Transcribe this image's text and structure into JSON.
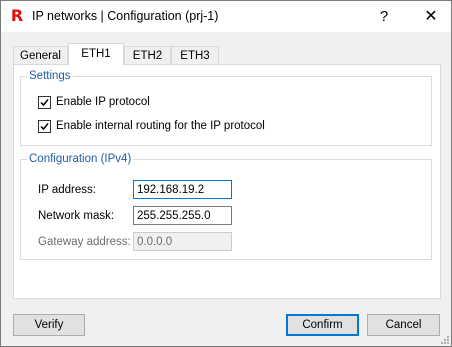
{
  "window": {
    "title": "IP networks | Configuration (prj-1)",
    "app_icon": "R",
    "help_glyph": "?",
    "close_glyph": "✕"
  },
  "tabs": [
    {
      "label": "General",
      "active": false
    },
    {
      "label": "ETH1",
      "active": true
    },
    {
      "label": "ETH2",
      "active": false
    },
    {
      "label": "ETH3",
      "active": false
    }
  ],
  "settings": {
    "legend": "Settings",
    "enable_ip": {
      "label": "Enable IP protocol",
      "checked": true
    },
    "enable_routing": {
      "label": "Enable internal routing for the IP protocol",
      "checked": true
    }
  },
  "config": {
    "legend": "Configuration (IPv4)",
    "ip": {
      "label": "IP address:",
      "value": "192.168.19.2"
    },
    "mask": {
      "label": "Network mask:",
      "value": "255.255.255.0"
    },
    "gateway": {
      "label": "Gateway address:",
      "value": "0.0.0.0",
      "disabled": true
    }
  },
  "buttons": {
    "verify": "Verify",
    "confirm": "Confirm",
    "cancel": "Cancel"
  },
  "colors": {
    "accent": "#0078d7",
    "legend": "#1f5ea8",
    "logo": "#e01010"
  },
  "icons": [
    "app-logo-icon",
    "help-icon",
    "close-icon",
    "checkmark-icon",
    "resize-grip-icon"
  ]
}
